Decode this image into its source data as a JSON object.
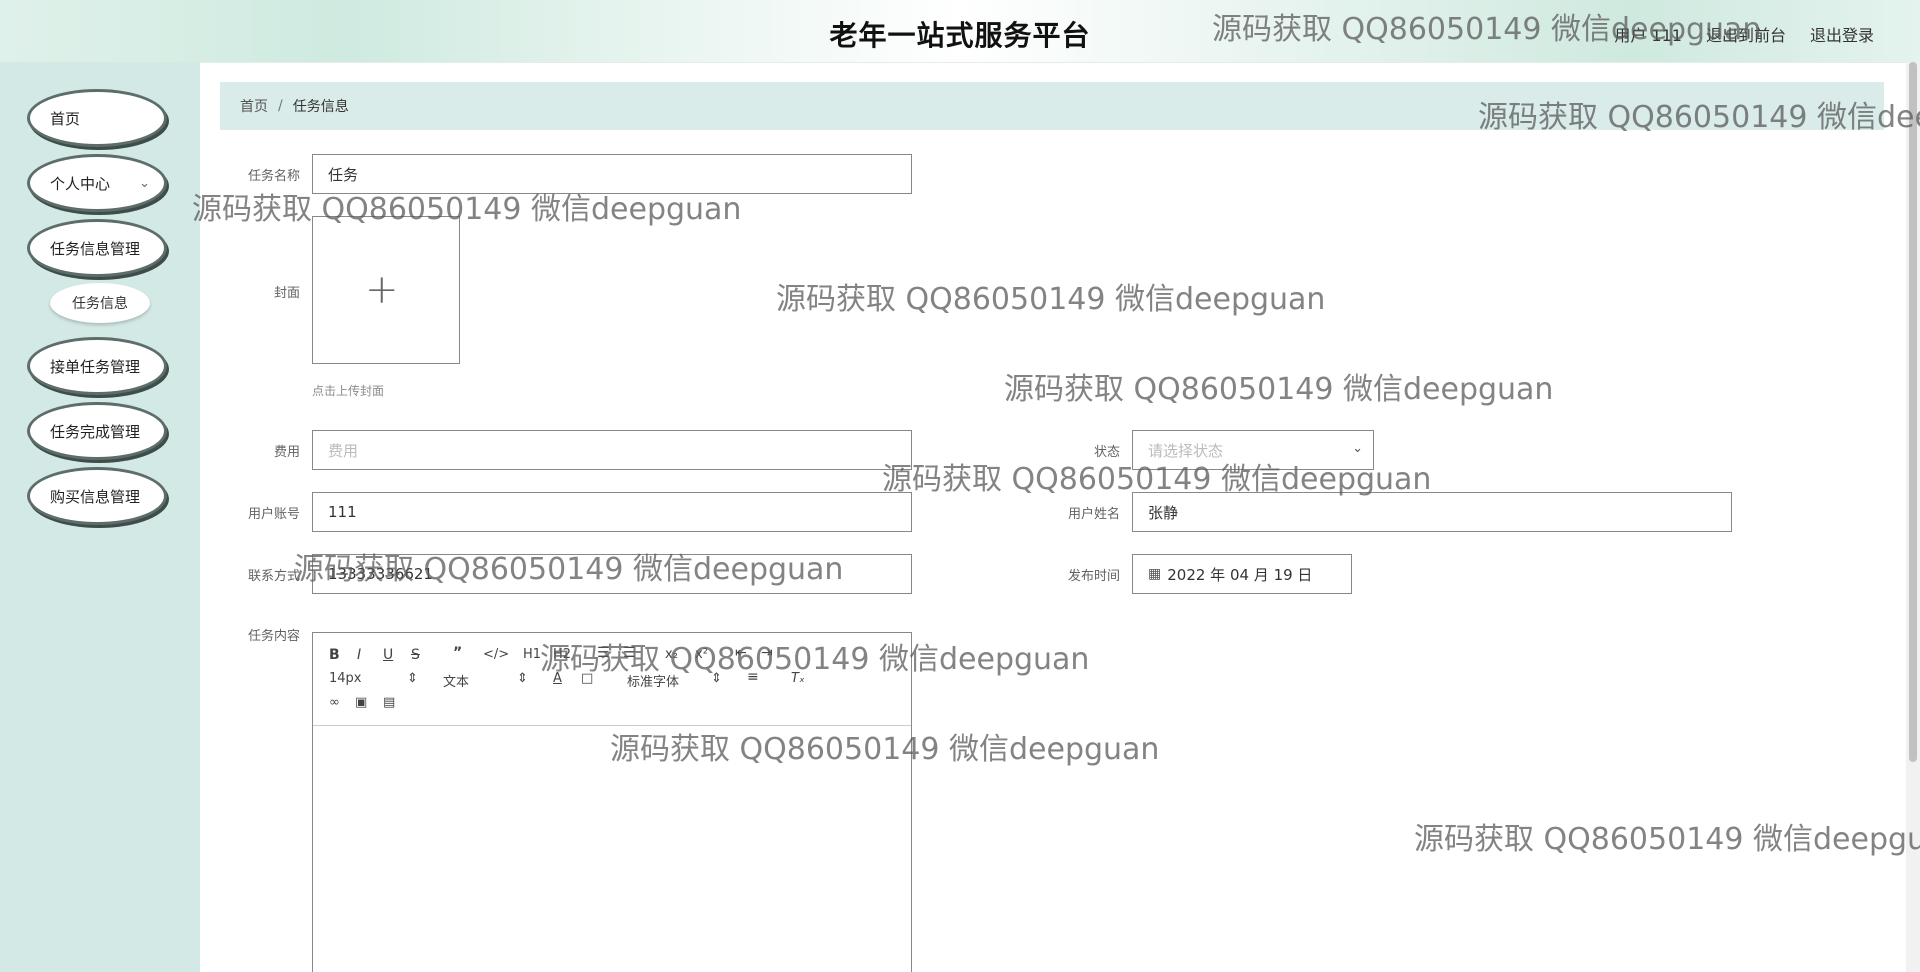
{
  "header": {
    "title": "老年一站式服务平台",
    "user": "用户 111",
    "back_to_front": "退出到前台",
    "logout": "退出登录"
  },
  "sidebar": {
    "items": [
      {
        "label": "首页"
      },
      {
        "label": "个人中心"
      },
      {
        "label": "任务信息管理"
      },
      {
        "label": "任务信息"
      },
      {
        "label": "接单任务管理"
      },
      {
        "label": "任务完成管理"
      },
      {
        "label": "购买信息管理"
      }
    ]
  },
  "breadcrumb": {
    "home": "首页",
    "separator": "/",
    "current": "任务信息"
  },
  "form": {
    "task_name_label": "任务名称",
    "task_name_value": "任务",
    "cover_label": "封面",
    "cover_tip": "点击上传封面",
    "fee_label": "费用",
    "fee_placeholder": "费用",
    "status_label": "状态",
    "status_placeholder": "请选择状态",
    "account_label": "用户账号",
    "account_value": "111",
    "username_label": "用户姓名",
    "username_value": "张静",
    "contact_label": "联系方式",
    "contact_value": "13333336621",
    "publish_time_label": "发布时间",
    "publish_time_value": "2022 年 04 月 19 日",
    "content_label": "任务内容"
  },
  "editor": {
    "font_size": "14px",
    "paragraph": "文本",
    "font_family": "标准字体",
    "heading1": "H1",
    "heading2": "H2"
  },
  "watermark": "源码获取 QQ86050149 微信deepguan"
}
